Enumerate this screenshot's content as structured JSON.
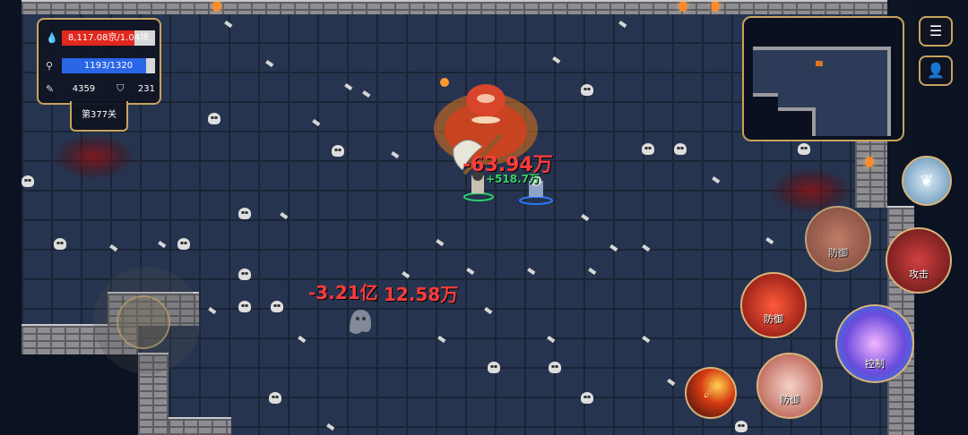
{
  "hud": {
    "hp": {
      "text": "8,117.08京/1.04垓",
      "fill_fraction": 0.78,
      "color": "#e0281f",
      "icon": "drop-icon"
    },
    "mp": {
      "text": "1193/1320",
      "fill_fraction": 0.9,
      "color": "#2a66e8",
      "icon": "magnifier-icon"
    },
    "attack": {
      "value": "4359",
      "icon": "sword-icon"
    },
    "defense": {
      "value": "231",
      "icon": "shield-icon"
    },
    "level_label": "第377关"
  },
  "buttons": {
    "menu_icon": "menu-icon",
    "profile_icon": "person-icon"
  },
  "combat": {
    "boss_damage": "-63.94万",
    "heal": "+518.7万",
    "ghost_damage_1": "-3.21亿",
    "ghost_damage_2": "12.58万"
  },
  "skills": {
    "top_ultimate": {
      "label": "",
      "icon": "angel-wings-icon"
    },
    "defense_a": {
      "label": "防御"
    },
    "attack": {
      "label": "攻击"
    },
    "defense_b": {
      "label": "防御"
    },
    "control": {
      "label": "控制"
    },
    "fireball": {
      "label": "",
      "icon": "meteor-icon"
    },
    "defense_c": {
      "label": "防御"
    }
  },
  "colors": {
    "frame_gold": "#c9a45c",
    "damage_red": "#ff3b3b",
    "heal_green": "#39d46a"
  }
}
